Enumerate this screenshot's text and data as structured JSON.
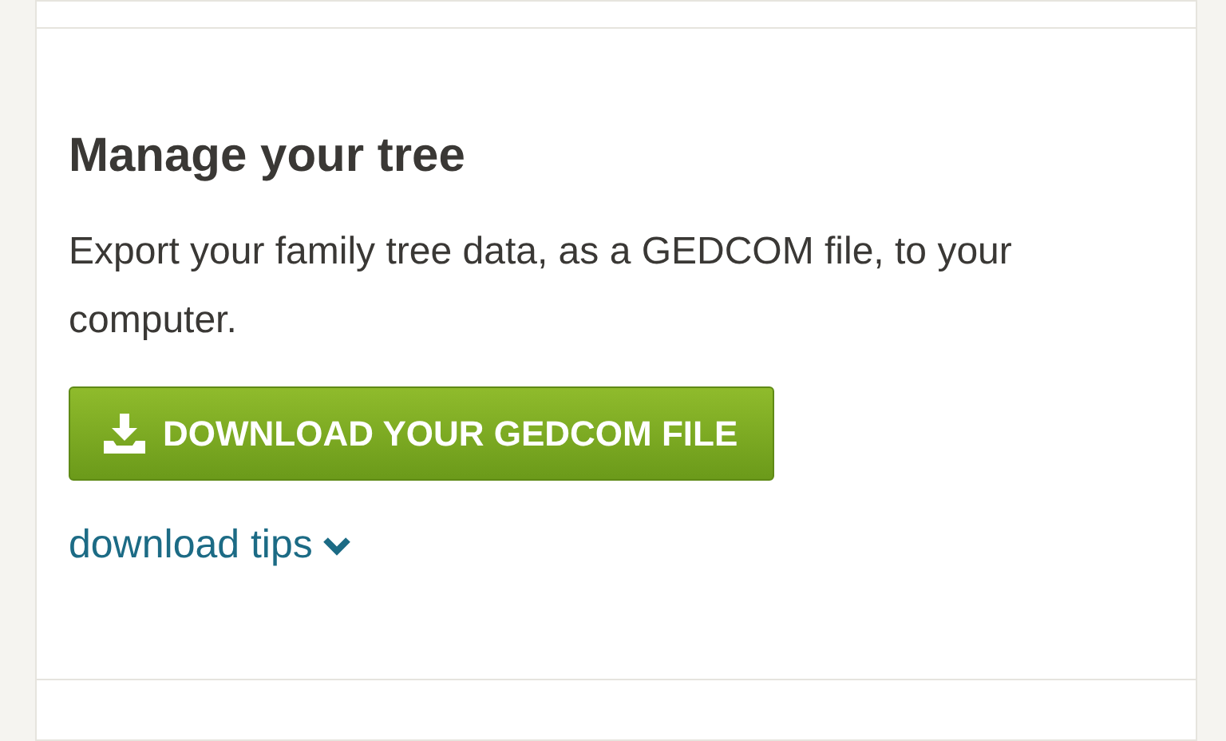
{
  "section": {
    "title": "Manage your tree",
    "description": "Export your family tree data, as a GEDCOM file, to your computer.",
    "button": {
      "label": "DOWNLOAD YOUR GEDCOM FILE"
    },
    "link": {
      "label": "download tips"
    }
  }
}
